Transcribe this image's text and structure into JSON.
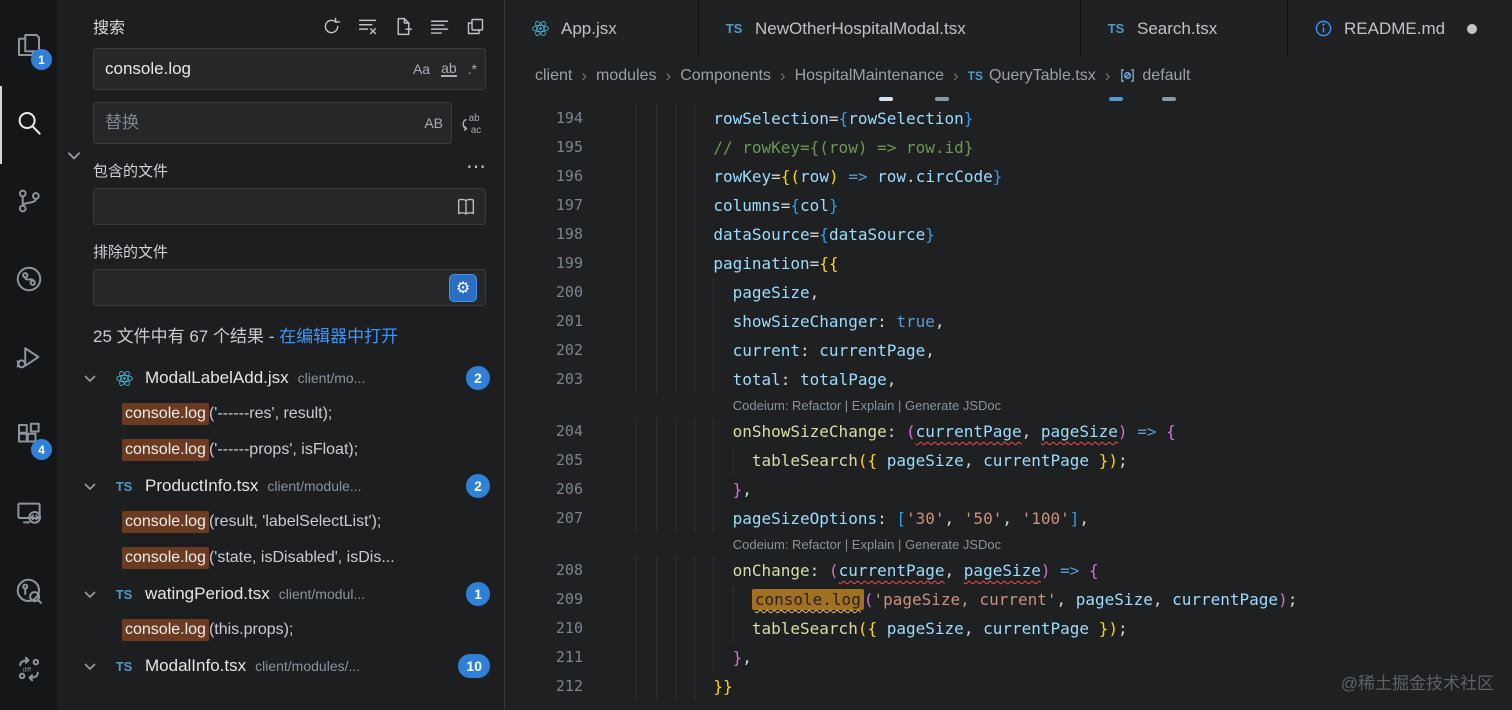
{
  "activity_bar": {
    "items": [
      {
        "name": "explorer",
        "badge": "1"
      },
      {
        "name": "search",
        "active": true
      },
      {
        "name": "source-control"
      },
      {
        "name": "git-graph"
      },
      {
        "name": "run-debug"
      },
      {
        "name": "extensions",
        "badge": "4"
      },
      {
        "name": "remote-explorer"
      },
      {
        "name": "gitlens"
      },
      {
        "name": "git-diff"
      }
    ]
  },
  "search_panel": {
    "title": "搜索",
    "toolbar": [
      {
        "name": "refresh"
      },
      {
        "name": "clear-results"
      },
      {
        "name": "new-search-editor"
      },
      {
        "name": "view-as-list"
      },
      {
        "name": "collapse-all"
      }
    ],
    "query": "console.log",
    "options": {
      "match_case": "Aa",
      "whole_word": "ab",
      "regex": ".*",
      "preserve_case": "AB"
    },
    "replace_placeholder": "替换",
    "include_label": "包含的文件",
    "exclude_label": "排除的文件",
    "summary_text": "25 文件中有 67 个结果 - ",
    "summary_link": "在编辑器中打开",
    "results": [
      {
        "file": "ModalLabelAdd.jsx",
        "icon": "react",
        "path": "client/mo...",
        "count": "2",
        "matches": [
          {
            "match": "console.log",
            "post": "('------res', result);"
          },
          {
            "match": "console.log",
            "post": "('------props', isFloat);"
          }
        ]
      },
      {
        "file": "ProductInfo.tsx",
        "icon": "ts",
        "path": "client/module...",
        "count": "2",
        "matches": [
          {
            "match": "console.log",
            "post": "(result, 'labelSelectList');"
          },
          {
            "match": "console.log",
            "post": "('state, isDisabled', isDis..."
          }
        ]
      },
      {
        "file": "watingPeriod.tsx",
        "icon": "ts",
        "path": "client/modul...",
        "count": "1",
        "matches": [
          {
            "match": "console.log",
            "post": "(this.props);"
          }
        ]
      },
      {
        "file": "ModalInfo.tsx",
        "icon": "ts",
        "path": "client/modules/...",
        "count": "10",
        "matches": []
      }
    ]
  },
  "editor": {
    "tabs": [
      {
        "label": "App.jsx",
        "icon": "react"
      },
      {
        "label": "NewOtherHospitalModal.tsx",
        "icon": "ts"
      },
      {
        "label": "Search.tsx",
        "icon": "ts"
      },
      {
        "label": "README.md",
        "icon": "info",
        "modified": true
      }
    ],
    "breadcrumb": [
      {
        "label": "client"
      },
      {
        "label": "modules"
      },
      {
        "label": "Components"
      },
      {
        "label": "HospitalMaintenance"
      },
      {
        "label": "QueryTable.tsx",
        "icon": "ts"
      },
      {
        "label": "default",
        "icon": "symbol"
      }
    ],
    "codelens_label": "Codeium: Refactor | Explain | Generate JSDoc",
    "code_lines": [
      {
        "sliver": true
      },
      {
        "num": "194",
        "indent": 10,
        "tokens": [
          {
            "t": "rowSelection",
            "c": "attr"
          },
          {
            "t": "=",
            "c": "pun"
          },
          {
            "t": "{",
            "c": "bb"
          },
          {
            "t": "rowSelection",
            "c": "var"
          },
          {
            "t": "}",
            "c": "bb"
          }
        ]
      },
      {
        "num": "195",
        "indent": 10,
        "tokens": [
          {
            "t": "// rowKey={(row) => row.id}",
            "c": "com"
          }
        ]
      },
      {
        "num": "196",
        "indent": 10,
        "tokens": [
          {
            "t": "rowKey",
            "c": "attr"
          },
          {
            "t": "=",
            "c": "pun"
          },
          {
            "t": "{",
            "c": "bg"
          },
          {
            "t": "(",
            "c": "bg"
          },
          {
            "t": "row",
            "c": "var"
          },
          {
            "t": ")",
            "c": "bg"
          },
          {
            "t": " ",
            "c": "pun"
          },
          {
            "t": "=>",
            "c": "kw"
          },
          {
            "t": " ",
            "c": "pun"
          },
          {
            "t": "row",
            "c": "var"
          },
          {
            "t": ".",
            "c": "pun"
          },
          {
            "t": "circCode",
            "c": "var"
          },
          {
            "t": "}",
            "c": "bb"
          }
        ]
      },
      {
        "num": "197",
        "indent": 10,
        "tokens": [
          {
            "t": "columns",
            "c": "attr"
          },
          {
            "t": "=",
            "c": "pun"
          },
          {
            "t": "{",
            "c": "bb"
          },
          {
            "t": "col",
            "c": "var"
          },
          {
            "t": "}",
            "c": "bb"
          }
        ]
      },
      {
        "num": "198",
        "indent": 10,
        "tokens": [
          {
            "t": "dataSource",
            "c": "attr"
          },
          {
            "t": "=",
            "c": "pun"
          },
          {
            "t": "{",
            "c": "bb"
          },
          {
            "t": "dataSource",
            "c": "var"
          },
          {
            "t": "}",
            "c": "bb"
          }
        ]
      },
      {
        "num": "199",
        "indent": 10,
        "tokens": [
          {
            "t": "pagination",
            "c": "attr"
          },
          {
            "t": "=",
            "c": "pun"
          },
          {
            "t": "{{",
            "c": "bg"
          }
        ]
      },
      {
        "num": "200",
        "indent": 12,
        "tokens": [
          {
            "t": "pageSize",
            "c": "var"
          },
          {
            "t": ",",
            "c": "pun"
          }
        ]
      },
      {
        "num": "201",
        "indent": 12,
        "tokens": [
          {
            "t": "showSizeChanger",
            "c": "var"
          },
          {
            "t": ": ",
            "c": "pun"
          },
          {
            "t": "true",
            "c": "kw"
          },
          {
            "t": ",",
            "c": "pun"
          }
        ]
      },
      {
        "num": "202",
        "indent": 12,
        "tokens": [
          {
            "t": "current",
            "c": "var"
          },
          {
            "t": ": ",
            "c": "pun"
          },
          {
            "t": "currentPage",
            "c": "var"
          },
          {
            "t": ",",
            "c": "pun"
          }
        ]
      },
      {
        "num": "203",
        "indent": 12,
        "tokens": [
          {
            "t": "total",
            "c": "var"
          },
          {
            "t": ": ",
            "c": "pun"
          },
          {
            "t": "totalPage",
            "c": "var"
          },
          {
            "t": ",",
            "c": "pun"
          }
        ]
      },
      {
        "lens": true,
        "indent": 12
      },
      {
        "num": "204",
        "indent": 12,
        "tokens": [
          {
            "t": "onShowSizeChange",
            "c": "fn"
          },
          {
            "t": ": ",
            "c": "pun"
          },
          {
            "t": "(",
            "c": "bp"
          },
          {
            "t": "currentPage",
            "c": "var sqr"
          },
          {
            "t": ", ",
            "c": "pun"
          },
          {
            "t": "pageSize",
            "c": "var sqr"
          },
          {
            "t": ")",
            "c": "bp"
          },
          {
            "t": " ",
            "c": "pun"
          },
          {
            "t": "=>",
            "c": "kw"
          },
          {
            "t": " ",
            "c": "pun"
          },
          {
            "t": "{",
            "c": "bp"
          }
        ]
      },
      {
        "num": "205",
        "indent": 14,
        "tokens": [
          {
            "t": "tableSearch",
            "c": "fn"
          },
          {
            "t": "(",
            "c": "bg"
          },
          {
            "t": "{",
            "c": "bg"
          },
          {
            "t": " ",
            "c": "pun"
          },
          {
            "t": "pageSize",
            "c": "var"
          },
          {
            "t": ", ",
            "c": "pun"
          },
          {
            "t": "currentPage",
            "c": "var"
          },
          {
            "t": " ",
            "c": "pun"
          },
          {
            "t": "}",
            "c": "bg"
          },
          {
            "t": ")",
            "c": "bg"
          },
          {
            "t": ";",
            "c": "pun"
          }
        ]
      },
      {
        "num": "206",
        "indent": 12,
        "tokens": [
          {
            "t": "}",
            "c": "bp"
          },
          {
            "t": ",",
            "c": "pun"
          }
        ]
      },
      {
        "num": "207",
        "indent": 12,
        "tokens": [
          {
            "t": "pageSizeOptions",
            "c": "var"
          },
          {
            "t": ": ",
            "c": "pun"
          },
          {
            "t": "[",
            "c": "bb"
          },
          {
            "t": "'30'",
            "c": "str"
          },
          {
            "t": ", ",
            "c": "pun"
          },
          {
            "t": "'50'",
            "c": "str"
          },
          {
            "t": ", ",
            "c": "pun"
          },
          {
            "t": "'100'",
            "c": "str"
          },
          {
            "t": "]",
            "c": "bb"
          },
          {
            "t": ",",
            "c": "pun"
          }
        ]
      },
      {
        "lens": true,
        "indent": 12
      },
      {
        "num": "208",
        "indent": 12,
        "tokens": [
          {
            "t": "onChange",
            "c": "fn"
          },
          {
            "t": ": ",
            "c": "pun"
          },
          {
            "t": "(",
            "c": "bp"
          },
          {
            "t": "currentPage",
            "c": "var sqr"
          },
          {
            "t": ", ",
            "c": "pun"
          },
          {
            "t": "pageSize",
            "c": "var sqr"
          },
          {
            "t": ")",
            "c": "bp"
          },
          {
            "t": " ",
            "c": "pun"
          },
          {
            "t": "=>",
            "c": "kw"
          },
          {
            "t": " ",
            "c": "pun"
          },
          {
            "t": "{",
            "c": "bp"
          }
        ]
      },
      {
        "num": "209",
        "indent": 14,
        "tokens": [
          {
            "t": "console.log",
            "c": "match sqy"
          },
          {
            "t": "(",
            "c": "bp"
          },
          {
            "t": "'pageSize, current'",
            "c": "str"
          },
          {
            "t": ", ",
            "c": "pun"
          },
          {
            "t": "pageSize",
            "c": "var"
          },
          {
            "t": ", ",
            "c": "pun"
          },
          {
            "t": "currentPage",
            "c": "var"
          },
          {
            "t": ")",
            "c": "bp"
          },
          {
            "t": ";",
            "c": "pun"
          }
        ]
      },
      {
        "num": "210",
        "indent": 14,
        "tokens": [
          {
            "t": "tableSearch",
            "c": "fn"
          },
          {
            "t": "(",
            "c": "bg"
          },
          {
            "t": "{",
            "c": "bg"
          },
          {
            "t": " ",
            "c": "pun"
          },
          {
            "t": "pageSize",
            "c": "var"
          },
          {
            "t": ", ",
            "c": "pun"
          },
          {
            "t": "currentPage",
            "c": "var"
          },
          {
            "t": " ",
            "c": "pun"
          },
          {
            "t": "}",
            "c": "bg"
          },
          {
            "t": ")",
            "c": "bg"
          },
          {
            "t": ";",
            "c": "pun"
          }
        ]
      },
      {
        "num": "211",
        "indent": 12,
        "tokens": [
          {
            "t": "}",
            "c": "bp"
          },
          {
            "t": ",",
            "c": "pun"
          }
        ]
      },
      {
        "num": "212",
        "indent": 10,
        "tokens": [
          {
            "t": "}}",
            "c": "bg"
          }
        ]
      }
    ]
  },
  "watermark": "@稀土掘金技术社区",
  "colors": {
    "accent_blue": "#2f81d8",
    "link_blue": "#3b97ff",
    "sidebar_match_bg": "#6b3a20",
    "editor_match_bg": "#9f7120",
    "ts_icon": "#4f9bc8",
    "react_icon": "#45b8d8"
  }
}
